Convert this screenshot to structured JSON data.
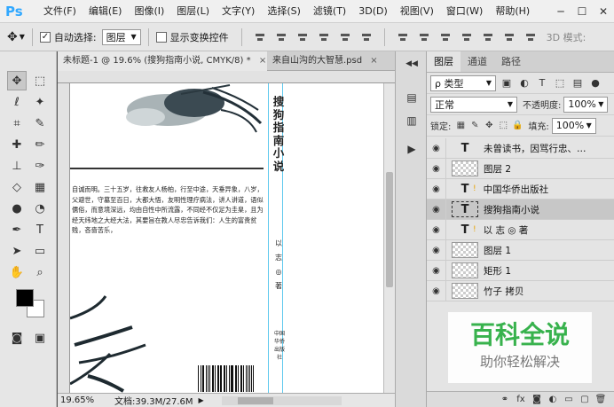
{
  "app": {
    "logo": "Ps"
  },
  "menu": [
    "文件(F)",
    "编辑(E)",
    "图像(I)",
    "图层(L)",
    "文字(Y)",
    "选择(S)",
    "滤镜(T)",
    "3D(D)",
    "视图(V)",
    "窗口(W)",
    "帮助(H)"
  ],
  "window_controls": {
    "minimize": "─",
    "maximize": "☐",
    "close": "✕"
  },
  "options": {
    "move_icon": "✥",
    "auto_select_label": "自动选择:",
    "auto_select_checked": "✓",
    "auto_select_value": "图层",
    "show_transform_label": "显示变换控件",
    "mode_label": "3D 模式:"
  },
  "doc_tabs": [
    {
      "title": "未标题-1 @ 19.6% (搜狗指南小说, CMYK/8) *",
      "close": "×"
    },
    {
      "title": "来自山沟的大智慧.psd",
      "close": "×"
    }
  ],
  "document": {
    "body_text": "自诚而明。三十五岁，往救友人杨柏，行至中途，天垂异象，八岁，父避世，守墓至百日，大都大悟，友明性理疗病法，讲人讲道，语似儒俗，而意境深远，均由自性中所流露，不同经不仅足为圭臬，且为经天纬地之大经大法，其要旨在教人尽忠告诉我们：人生的富贵贫贱，吝啬苦乐，",
    "spine_title": "搜狗指南小说",
    "spine_author": "以志◎著",
    "spine_publisher": "中国华侨出版社"
  },
  "status": {
    "zoom": "19.65%",
    "doc_size": "文档:39.3M/27.6M",
    "arrow": "▶"
  },
  "panel": {
    "tabs": [
      "图层",
      "通道",
      "路径"
    ],
    "filter_kind": "ρ 类型",
    "blend_mode": "正常",
    "opacity_label": "不透明度:",
    "opacity_value": "100%",
    "lock_label": "锁定:",
    "fill_label": "填充:",
    "fill_value": "100%"
  },
  "layers": [
    {
      "name": "未曾读书，因骂行忠、…",
      "thumb": "T",
      "kind": "text",
      "selected": false,
      "warn": false
    },
    {
      "name": "图层 2",
      "thumb": "",
      "kind": "raster",
      "selected": false,
      "warn": false
    },
    {
      "name": "中国华侨出版社",
      "thumb": "T",
      "kind": "text",
      "selected": false,
      "warn": true
    },
    {
      "name": "搜狗指南小说",
      "thumb": "T",
      "kind": "text-sel",
      "selected": true,
      "warn": false
    },
    {
      "name": "以  志  ◎  著",
      "thumb": "T",
      "kind": "text",
      "selected": false,
      "warn": true
    },
    {
      "name": "图层 1",
      "thumb": "",
      "kind": "raster",
      "selected": false,
      "warn": false
    },
    {
      "name": "矩形 1",
      "thumb": "",
      "kind": "raster",
      "selected": false,
      "warn": false
    },
    {
      "name": "竹子 拷贝",
      "thumb": "",
      "kind": "raster",
      "selected": false,
      "warn": false
    }
  ],
  "watermark": {
    "title": "百科全说",
    "subtitle": "助你轻松解决"
  }
}
